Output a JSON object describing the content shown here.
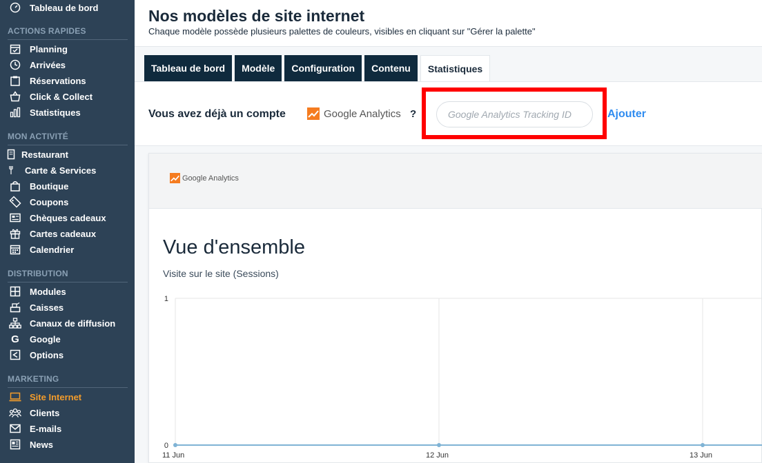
{
  "sidebar": {
    "top_item": {
      "label": "Tableau de bord",
      "icon": "gauge-icon"
    },
    "sections": [
      {
        "title": "ACTIONS RAPIDES",
        "items": [
          {
            "label": "Planning",
            "icon": "calendar-check-icon"
          },
          {
            "label": "Arrivées",
            "icon": "clock-icon"
          },
          {
            "label": "Réservations",
            "icon": "clipboard-icon"
          },
          {
            "label": "Click & Collect",
            "icon": "shopping-basket-icon"
          },
          {
            "label": "Statistiques",
            "icon": "bar-chart-icon"
          }
        ]
      },
      {
        "title": "MON ACTIVITÉ",
        "items": [
          {
            "label": "Restaurant",
            "icon": "building-icon"
          },
          {
            "label": "Carte & Services",
            "icon": "utensils-icon"
          },
          {
            "label": "Boutique",
            "icon": "shopping-bag-icon"
          },
          {
            "label": "Coupons",
            "icon": "tag-icon"
          },
          {
            "label": "Chèques cadeaux",
            "icon": "voucher-icon"
          },
          {
            "label": "Cartes cadeaux",
            "icon": "gift-icon"
          },
          {
            "label": "Calendrier",
            "icon": "calendar-icon"
          }
        ]
      },
      {
        "title": "DISTRIBUTION",
        "items": [
          {
            "label": "Modules",
            "icon": "grid-icon"
          },
          {
            "label": "Caisses",
            "icon": "cash-register-icon"
          },
          {
            "label": "Canaux de diffusion",
            "icon": "sitemap-icon"
          },
          {
            "label": "Google",
            "icon": "google-icon"
          },
          {
            "label": "Options",
            "icon": "share-icon"
          }
        ]
      },
      {
        "title": "MARKETING",
        "items": [
          {
            "label": "Site Internet",
            "icon": "laptop-icon",
            "active": true
          },
          {
            "label": "Clients",
            "icon": "users-icon"
          },
          {
            "label": "E-mails",
            "icon": "envelope-icon"
          },
          {
            "label": "News",
            "icon": "newspaper-icon"
          }
        ]
      }
    ]
  },
  "header": {
    "title": "Nos modèles de site internet",
    "subtitle": "Chaque modèle possède plusieurs palettes de couleurs, visibles en cliquant sur \"Gérer la palette\""
  },
  "tabs": [
    {
      "label": "Tableau de bord"
    },
    {
      "label": "Modèle"
    },
    {
      "label": "Configuration"
    },
    {
      "label": "Contenu"
    },
    {
      "label": "Statistiques",
      "active": true
    }
  ],
  "analytics": {
    "account_label": "Vous avez déjà un compte",
    "ga_logo_text": "Google Analytics",
    "help": "?",
    "tracking_placeholder": "Google Analytics Tracking ID",
    "add_label": "Ajouter",
    "highlight_color": "#ff0000",
    "link_color": "#2f8cf0"
  },
  "card": {
    "ga_logo_text": "Google Analytics",
    "title": "Vue d'ensemble",
    "caption": "Visite sur le site (Sessions)"
  },
  "chart_data": {
    "type": "line",
    "title": "",
    "x": [
      "11 Jun",
      "12 Jun",
      "13 Jun"
    ],
    "series": [
      {
        "values": [
          0,
          0,
          0
        ]
      }
    ],
    "ylim": [
      0,
      1
    ],
    "yticks": [
      "1",
      "0"
    ],
    "grid": true,
    "line_color": "#7fb3d5"
  },
  "colors": {
    "sidebar_bg": "#2d4256",
    "active_accent": "#f39c2b",
    "tab_bg": "#0f2a3d"
  }
}
